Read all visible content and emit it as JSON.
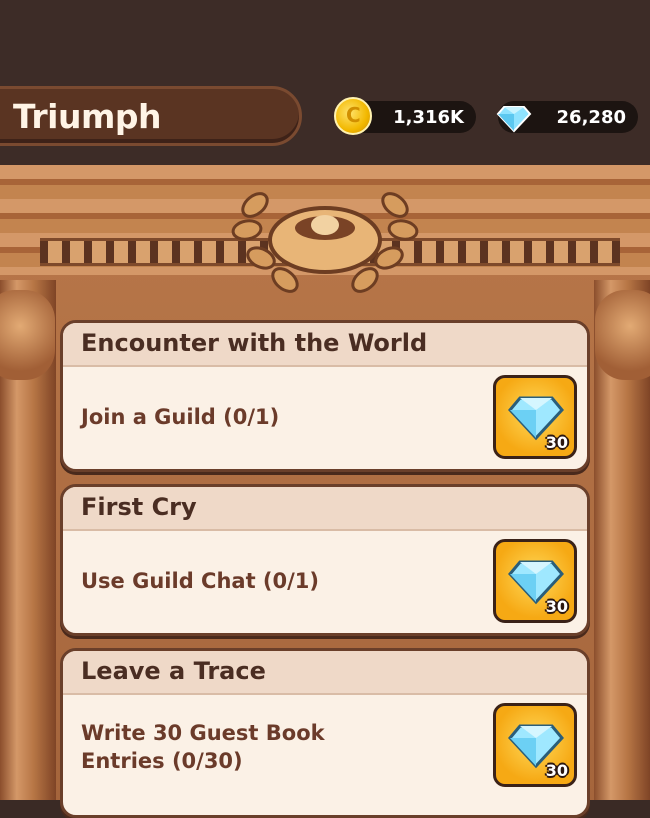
{
  "header": {
    "title": "Triumph",
    "coins": "1,316K",
    "gems": "26,280"
  },
  "colors": {
    "card_bg": "#fbf1e6",
    "reward_bg": "#f6a914",
    "text_brown": "#4a2d22"
  },
  "achievements": [
    {
      "title": "Encounter with the World",
      "desc": "Join a Guild (0/1)",
      "reward_icon": "diamond-icon",
      "reward_qty": "30"
    },
    {
      "title": "First Cry",
      "desc": "Use Guild Chat (0/1)",
      "reward_icon": "diamond-icon",
      "reward_qty": "30"
    },
    {
      "title": "Leave a Trace",
      "desc": "Write 30 Guest Book Entries (0/30)",
      "reward_icon": "diamond-icon",
      "reward_qty": "30"
    }
  ]
}
